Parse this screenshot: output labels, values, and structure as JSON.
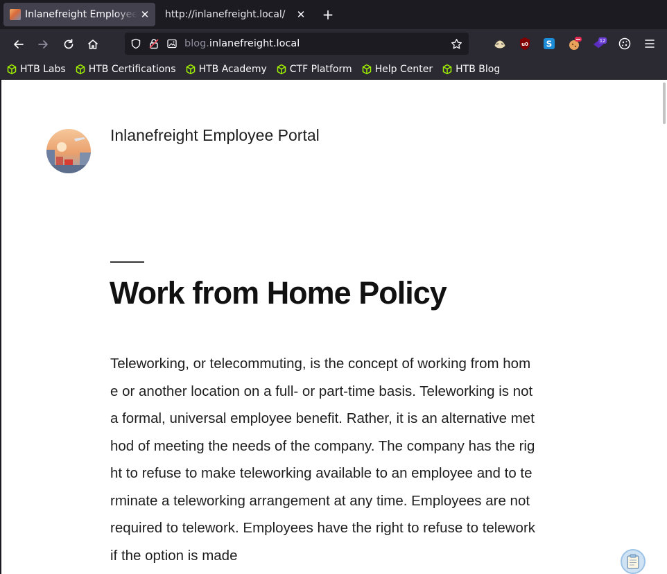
{
  "tabs": [
    {
      "title": "Inlanefreight Employee Portal",
      "active": true
    },
    {
      "title": "http://inlanefreight.local/",
      "active": false
    }
  ],
  "newtab_symbol": "+",
  "tab_close_symbol": "✕",
  "urlbar": {
    "subdomain": "blog.",
    "domain": "inlanefreight.local"
  },
  "extensions": {
    "ublock_label": "u0",
    "badge_count": "12"
  },
  "bookmarks": [
    {
      "label": "HTB Labs",
      "icon": "htb-cube-icon"
    },
    {
      "label": "HTB Certifications",
      "icon": "htb-cube-icon"
    },
    {
      "label": "HTB Academy",
      "icon": "htb-cube-icon"
    },
    {
      "label": "CTF Platform",
      "icon": "htb-cube-icon"
    },
    {
      "label": "Help Center",
      "icon": "htb-cube-icon"
    },
    {
      "label": "HTB Blog",
      "icon": "htb-cube-icon"
    }
  ],
  "page": {
    "site_title": "Inlanefreight Employee Portal",
    "post_title": "Work from Home Policy",
    "post_body": "Teleworking, or telecommuting, is the concept of working from home or another location on a full- or part-time basis. Teleworking is not a formal, universal employee benefit. Rather, it is an alternative method of meeting the needs of the company. The company has the right to refuse to make teleworking available to an employee and to terminate a teleworking arrangement at any time. Employees are not required to telework. Employees have the right to refuse to telework if the option is made"
  },
  "colors": {
    "chrome_dark": "#1c1b22",
    "toolbar": "#2b2a33",
    "active_tab": "#42414d",
    "htb_green": "#9fef00"
  }
}
